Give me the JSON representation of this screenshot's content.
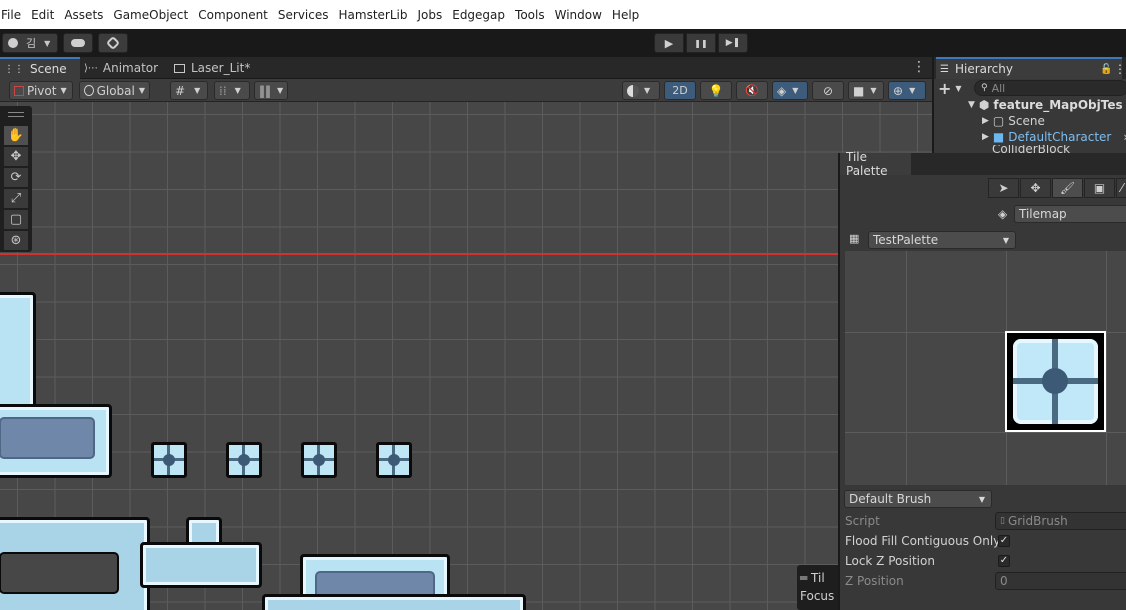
{
  "menu": [
    "File",
    "Edit",
    "Assets",
    "GameObject",
    "Component",
    "Services",
    "HamsterLib",
    "Jobs",
    "Edgegap",
    "Tools",
    "Window",
    "Help"
  ],
  "toolbar": {
    "account_label": "김",
    "account_icon": "account-icon",
    "cloud_icon": "cloud-icon",
    "collab_icon": "collab-icon",
    "play_glyph": "▶",
    "pause_glyph": "❚❚",
    "step_glyph": "▶❚"
  },
  "scene_tabs": [
    {
      "label": "Scene",
      "icon": "grid-icon",
      "active": true
    },
    {
      "label": "Animator",
      "icon": "animator-icon",
      "active": false
    },
    {
      "label": "Laser_Lit*",
      "icon": "folder-icon",
      "active": false
    }
  ],
  "scene_toolbar": {
    "pivot_label": "Pivot",
    "global_label": "Global",
    "mode_2d_label": "2D"
  },
  "tile_overlay": {
    "line1": "Til",
    "line2": "Focus"
  },
  "hierarchy": {
    "title": "Hierarchy",
    "search_placeholder": "All",
    "root": "feature_MapObjTes",
    "items": [
      "Scene",
      "DefaultCharacter",
      "ColliderBlock"
    ]
  },
  "tile_palette": {
    "title": "Tile Palette",
    "target_label": "Tilemap",
    "palette_name": "TestPalette",
    "brush_name": "Default Brush",
    "properties": {
      "script_label": "Script",
      "script_value": "GridBrush",
      "flood_label": "Flood Fill Contiguous Only",
      "flood_checked": "✓",
      "lockz_label": "Lock Z Position",
      "lockz_checked": "✓",
      "zpos_label": "Z Position",
      "zpos_value": "0"
    }
  },
  "colors": {
    "accent": "#3a79bb",
    "redline": "#d33030",
    "tile_light": "#bfe6f5",
    "tile_dark": "#4a6a82"
  }
}
